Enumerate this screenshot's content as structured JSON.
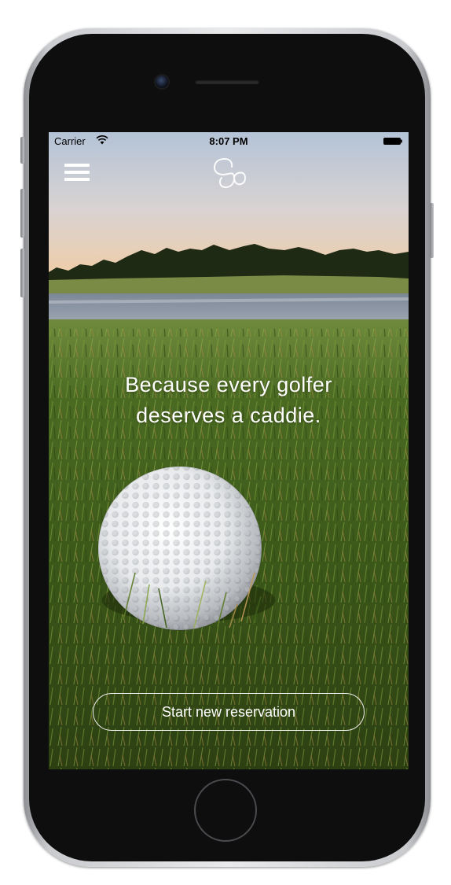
{
  "status_bar": {
    "carrier": "Carrier",
    "time": "8:07 PM"
  },
  "header": {
    "menu_icon": "hamburger-menu-icon",
    "logo_icon": "infinity-loop-logo-icon"
  },
  "hero": {
    "tagline": "Because every golfer deserves a caddie."
  },
  "actions": {
    "start_reservation_label": "Start new reservation"
  },
  "colors": {
    "text": "#ffffff",
    "sky_top": "#b9c6d6",
    "sky_bottom": "#e9c9a6",
    "grass": "#3e5a1c"
  }
}
